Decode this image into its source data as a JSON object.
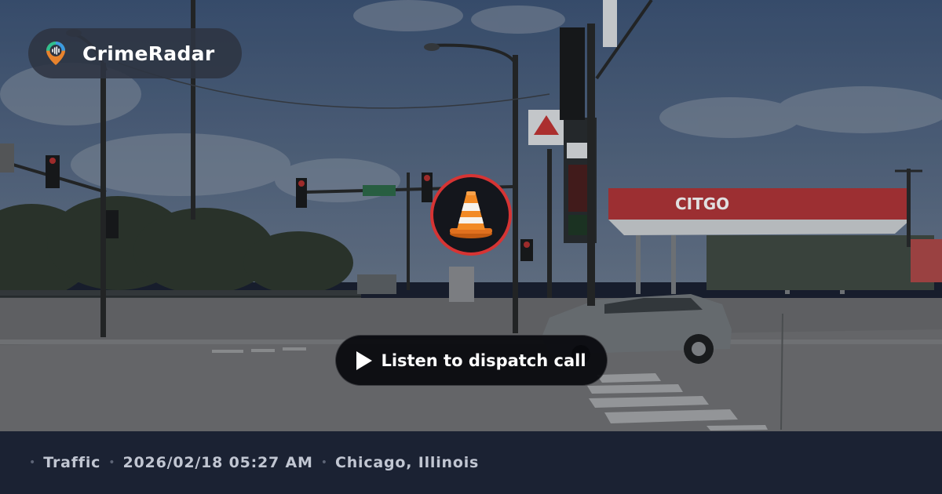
{
  "brand": {
    "name": "CrimeRadar",
    "logo_icon": "radar-pin-icon"
  },
  "incident": {
    "category_icon": "traffic-cone-icon",
    "ring_color": "#d63434"
  },
  "player": {
    "button_label": "Listen to dispatch call",
    "play_icon": "play-icon"
  },
  "footer": {
    "separator": "•",
    "category": "Traffic",
    "datetime": "2026/02/18 05:27 AM",
    "location": "Chicago, Illinois"
  },
  "scene": {
    "station_sign": "CITGO",
    "accent_color": "#d63434"
  }
}
